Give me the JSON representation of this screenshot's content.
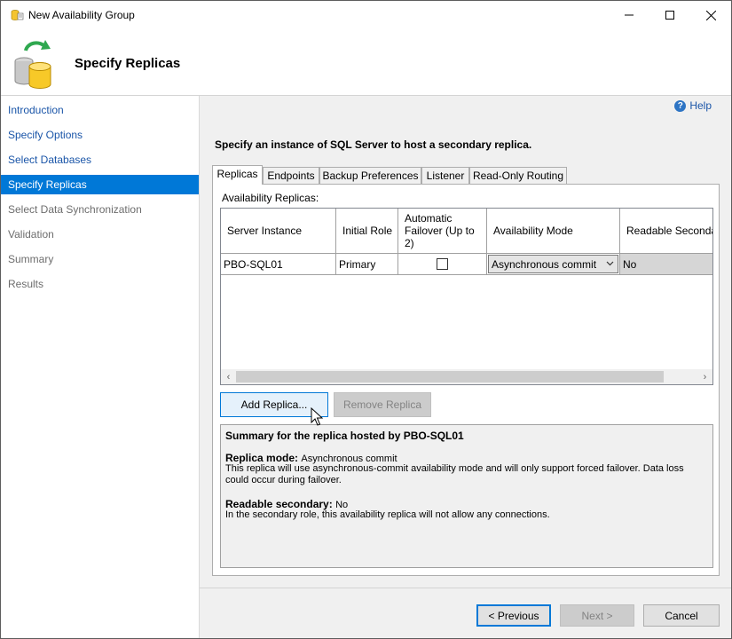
{
  "window": {
    "title": "New Availability Group",
    "controls": [
      "minimize-icon",
      "maximize-icon",
      "close-icon"
    ]
  },
  "header": {
    "title": "Specify Replicas",
    "icon": "database-sync-icon"
  },
  "sidebar": {
    "items": [
      {
        "label": "Introduction",
        "state": "link"
      },
      {
        "label": "Specify Options",
        "state": "link"
      },
      {
        "label": "Select Databases",
        "state": "link"
      },
      {
        "label": "Specify Replicas",
        "state": "active"
      },
      {
        "label": "Select Data Synchronization",
        "state": "disabled"
      },
      {
        "label": "Validation",
        "state": "disabled"
      },
      {
        "label": "Summary",
        "state": "disabled"
      },
      {
        "label": "Results",
        "state": "disabled"
      }
    ]
  },
  "main": {
    "help_label": "Help",
    "instruction": "Specify an instance of SQL Server to host a secondary replica.",
    "tabs": [
      {
        "label": "Replicas",
        "active": true
      },
      {
        "label": "Endpoints",
        "active": false
      },
      {
        "label": "Backup Preferences",
        "active": false
      },
      {
        "label": "Listener",
        "active": false
      },
      {
        "label": "Read-Only Routing",
        "active": false
      }
    ],
    "replicas_label": "Availability Replicas:",
    "columns": {
      "server_instance": "Server Instance",
      "initial_role": "Initial Role",
      "automatic_failover": "Automatic Failover (Up to 2)",
      "availability_mode": "Availability Mode",
      "readable_secondary": "Readable Secondar"
    },
    "rows": [
      {
        "server_instance": "PBO-SQL01",
        "initial_role": "Primary",
        "automatic_failover": false,
        "availability_mode": "Asynchronous commit",
        "readable_secondary": "No"
      }
    ],
    "buttons": {
      "add_replica": "Add Replica...",
      "remove_replica": "Remove Replica"
    },
    "summary": {
      "title": "Summary for the replica hosted by PBO-SQL01",
      "replica_mode_label": "Replica mode:",
      "replica_mode_value": "Asynchronous commit",
      "replica_mode_desc": "This replica will use asynchronous-commit availability mode and will only support forced failover. Data loss could occur during failover.",
      "readable_label": "Readable secondary:",
      "readable_value": "No",
      "readable_desc": "In the secondary role, this availability replica will not allow any connections."
    }
  },
  "footer": {
    "previous": "< Previous",
    "next": "Next >",
    "cancel": "Cancel"
  },
  "colors": {
    "accent": "#0078d7",
    "link": "#1a55a8"
  }
}
